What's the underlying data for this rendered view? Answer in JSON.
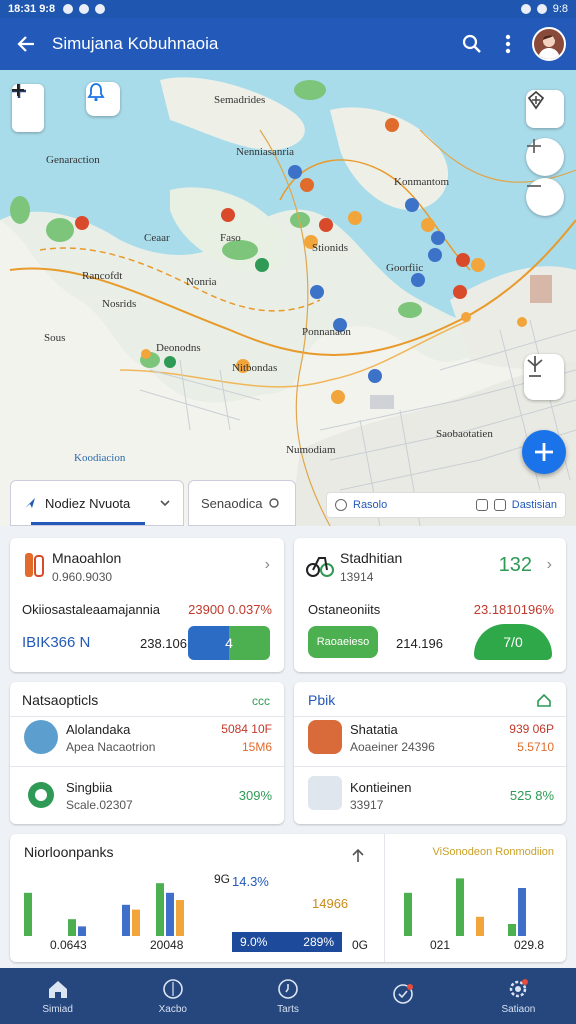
{
  "status": {
    "time": "18:31 9:8",
    "right": "9:8"
  },
  "appbar": {
    "title": "Simujana Kobuhnaoia"
  },
  "map": {
    "labels": [
      "Semadrides",
      "Nenniasanria",
      "Konmantom",
      "Genaraction",
      "Ceaar",
      "Faso",
      "Nonria",
      "Goorfiic",
      "Rancofdt",
      "Nosrids",
      "Stionids",
      "Ponnanaon",
      "Sous",
      "Deonodns",
      "Nitbondas",
      "Koodiacion",
      "Saobaotatien",
      "Numodiam"
    ]
  },
  "segments": {
    "tab1": "Nodiez Nvuota",
    "tab2": "Senaodica"
  },
  "filter": {
    "a": "Rasolo",
    "b": "Dastisian"
  },
  "card1": {
    "title": "Mnaoahlon",
    "sub": "0.960.9030",
    "metric_label": "Okiiosastaleaamajannia",
    "metric_value": "23900 0.037%",
    "code": "IBIK366 N",
    "num": "238.106",
    "pill": "4"
  },
  "card2": {
    "title": "Stadhitian",
    "sub": "13914",
    "value": "132",
    "metric_label": "Ostaneoniits",
    "metric_value": "23.1810196%",
    "pill_left": "Raoaeieso",
    "num": "214.196",
    "pill": "7/0"
  },
  "card3": {
    "header": "Natsaopticls",
    "header_right": "ccc",
    "items": [
      {
        "name": "Alolandaka",
        "sub": "Apea Nacaotrion",
        "v1": "5084 10F",
        "v2": "15M6"
      },
      {
        "name": "Singbiia",
        "sub": "Scale.02307",
        "v1": "309%",
        "v2": ""
      }
    ]
  },
  "card4": {
    "header": "Pbik",
    "items": [
      {
        "name": "Shatatia",
        "sub": "Aoaeiner 24396",
        "v1": "939 06P",
        "v2": "5.5710"
      },
      {
        "name": "Kontieinen",
        "sub": "33917",
        "v1": "525 8%",
        "v2": ""
      }
    ]
  },
  "card5": {
    "title": "Niorloonpanks",
    "y_label": "9G",
    "pct_top": "14.3%",
    "pct_right": "14966",
    "bar_left": "9.0%",
    "bar_right": "289%",
    "legend": "ViSonodeon Ronmodiion",
    "x_labels": [
      "0.0643",
      "20048",
      "0G",
      "021",
      "029.8"
    ],
    "colors": {
      "green": "#4caf50",
      "blue": "#3f6fc8",
      "orange": "#f2a53a"
    },
    "chart_left": [
      [
        36,
        0,
        0
      ],
      [
        14,
        8,
        0
      ],
      [
        0,
        26,
        22
      ],
      [
        44,
        36,
        30
      ]
    ],
    "chart_right": [
      [
        36,
        0,
        0
      ],
      [
        48,
        0,
        16
      ],
      [
        10,
        40,
        0
      ]
    ]
  },
  "nav": [
    "Simiad",
    "Xacbo",
    "Tarts",
    "",
    "Satiaon"
  ]
}
